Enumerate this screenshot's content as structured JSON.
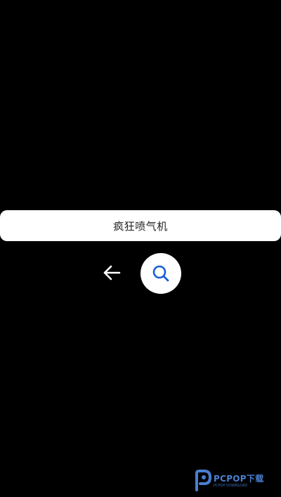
{
  "search": {
    "query": "疯狂喷气机"
  },
  "icons": {
    "back": "arrow-left-icon",
    "search": "magnifier-icon"
  },
  "colors": {
    "background": "#000000",
    "search_bar": "#ffffff",
    "search_icon": "#1a5fd6",
    "watermark": "#4a7fd0"
  },
  "watermark": {
    "brand": "PCPOP下载",
    "sub": "PCPOP DOWNLOAD"
  }
}
